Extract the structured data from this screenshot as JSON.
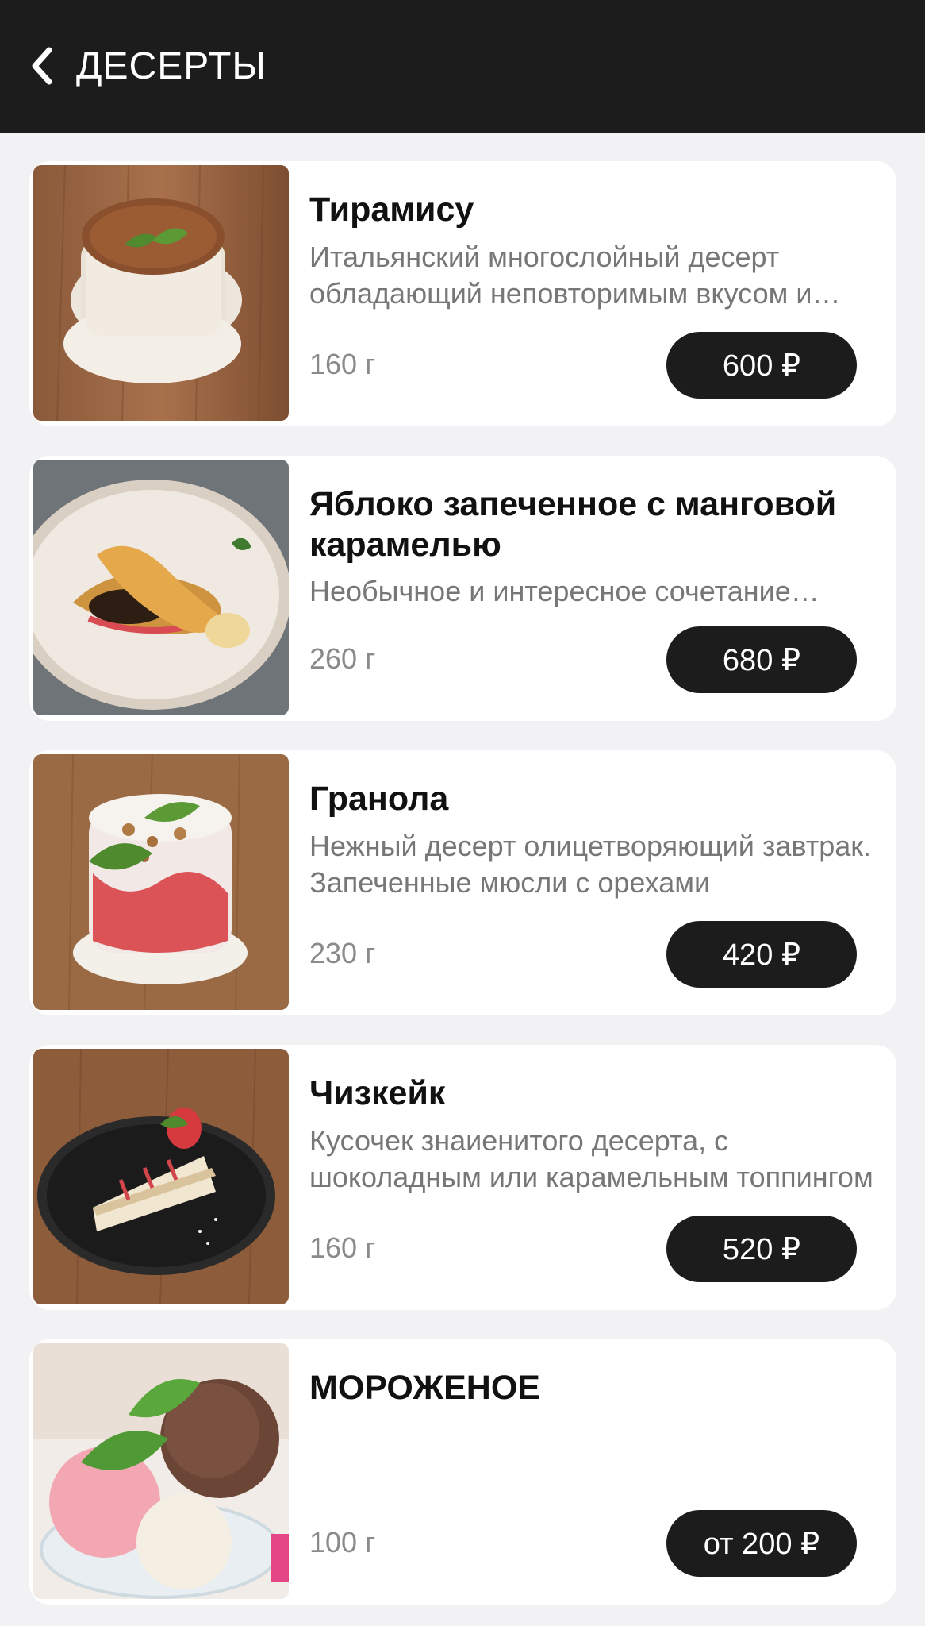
{
  "header": {
    "title": "ДЕСЕРТЫ"
  },
  "items": [
    {
      "name": "Тирамису",
      "desc": "Итальянский многослойный десерт обладающий неповторимым вкусом и нежной текстурой",
      "weight": "160 г",
      "price": "600 ₽"
    },
    {
      "name": "Яблоко запеченное с манговой карамелью",
      "desc": "Необычное и интересное сочетание вкусов",
      "weight": "260 г",
      "price": "680 ₽"
    },
    {
      "name": "Гранола",
      "desc": "Нежный десерт олицетворяющий завтрак. Запеченные мюсли с орехами",
      "weight": "230 г",
      "price": "420 ₽"
    },
    {
      "name": "Чизкейк",
      "desc": "Кусочек знаиенитого десерта, с шоколадным или карамельным топпингом",
      "weight": "160 г",
      "price": "520 ₽"
    },
    {
      "name": "МОРОЖЕНОЕ",
      "desc": "",
      "weight": "100 г",
      "price": "от 200 ₽"
    }
  ]
}
